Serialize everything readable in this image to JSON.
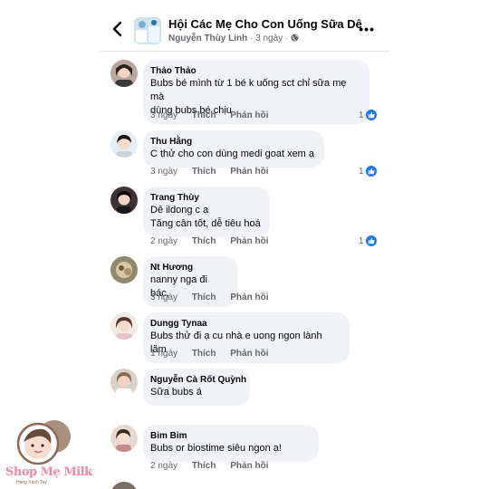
{
  "header": {
    "back_icon": "chevron-left-icon",
    "title": "Hội Các Mẹ Cho Con Uống Sữa Dê",
    "author": "Nguyễn Thùy Linh",
    "time": "3 ngày",
    "separator": "·",
    "privacy_icon": "globe-icon",
    "more_label": "•••"
  },
  "actions": {
    "like": "Thích",
    "reply": "Phản hồi"
  },
  "colors": {
    "like_blue": "#1877f2",
    "bubble": "#f0f2f5",
    "meta_gray": "#65676b"
  },
  "comments": [
    {
      "name": "Thảo Thảo",
      "text": "Bubs bé mình từ 1 bé k uống sct chỉ sữa mẹ mà\ndùng bubs bé chịu",
      "time": "3 ngày",
      "likes": "1"
    },
    {
      "name": "Thu Hằng",
      "text": "C thử cho con dùng medi goat xem ạ",
      "time": "3 ngày",
      "likes": "1"
    },
    {
      "name": "Trang Thùy",
      "text": "Dê ildong c ạ\nTăng cân tốt, dễ tiêu hoá",
      "time": "2 ngày",
      "likes": "1"
    },
    {
      "name": "Nt Hương",
      "text": "nanny nga đi bác,",
      "time": "3 ngày",
      "likes": ""
    },
    {
      "name": "Dungg Tynaa",
      "text": "Bubs thử đi ạ cu nhà e uong ngon lành lăm",
      "time": "1 ngày",
      "likes": ""
    },
    {
      "name": "Nguyễn Cà Rốt Quỳnh",
      "text": "Sữa bubs á",
      "time": "",
      "likes": ""
    },
    {
      "name": "Bim Bim",
      "text": "Bubs or biostime siêu ngon ạ!",
      "time": "2 ngày",
      "likes": ""
    }
  ],
  "watermark": {
    "brand": "Shop Mẹ Milk",
    "tagline": "Hàng Xách Tay"
  }
}
